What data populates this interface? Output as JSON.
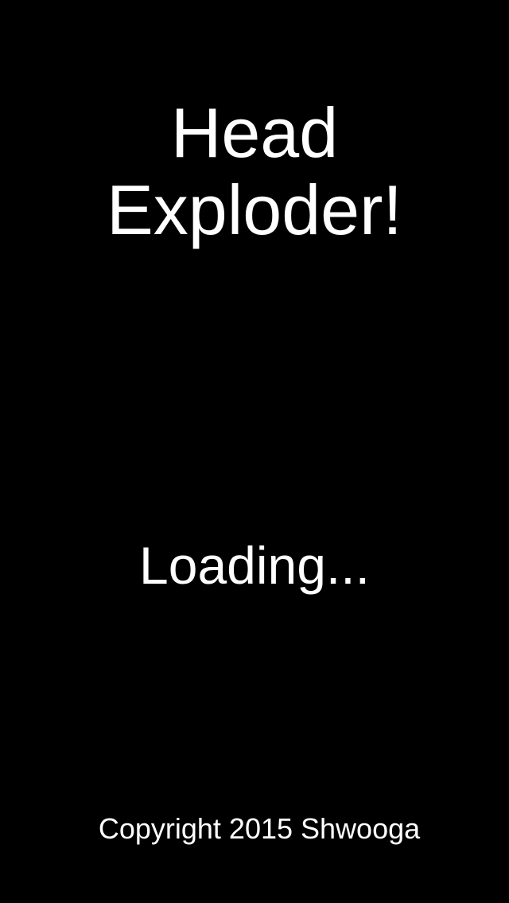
{
  "app": {
    "title_line1": "Head",
    "title_line2": "Exploder!",
    "loading_text": "Loading...",
    "copyright": "Copyright 2015 Shwooga"
  },
  "colors": {
    "background": "#000000",
    "text": "#ffffff"
  }
}
